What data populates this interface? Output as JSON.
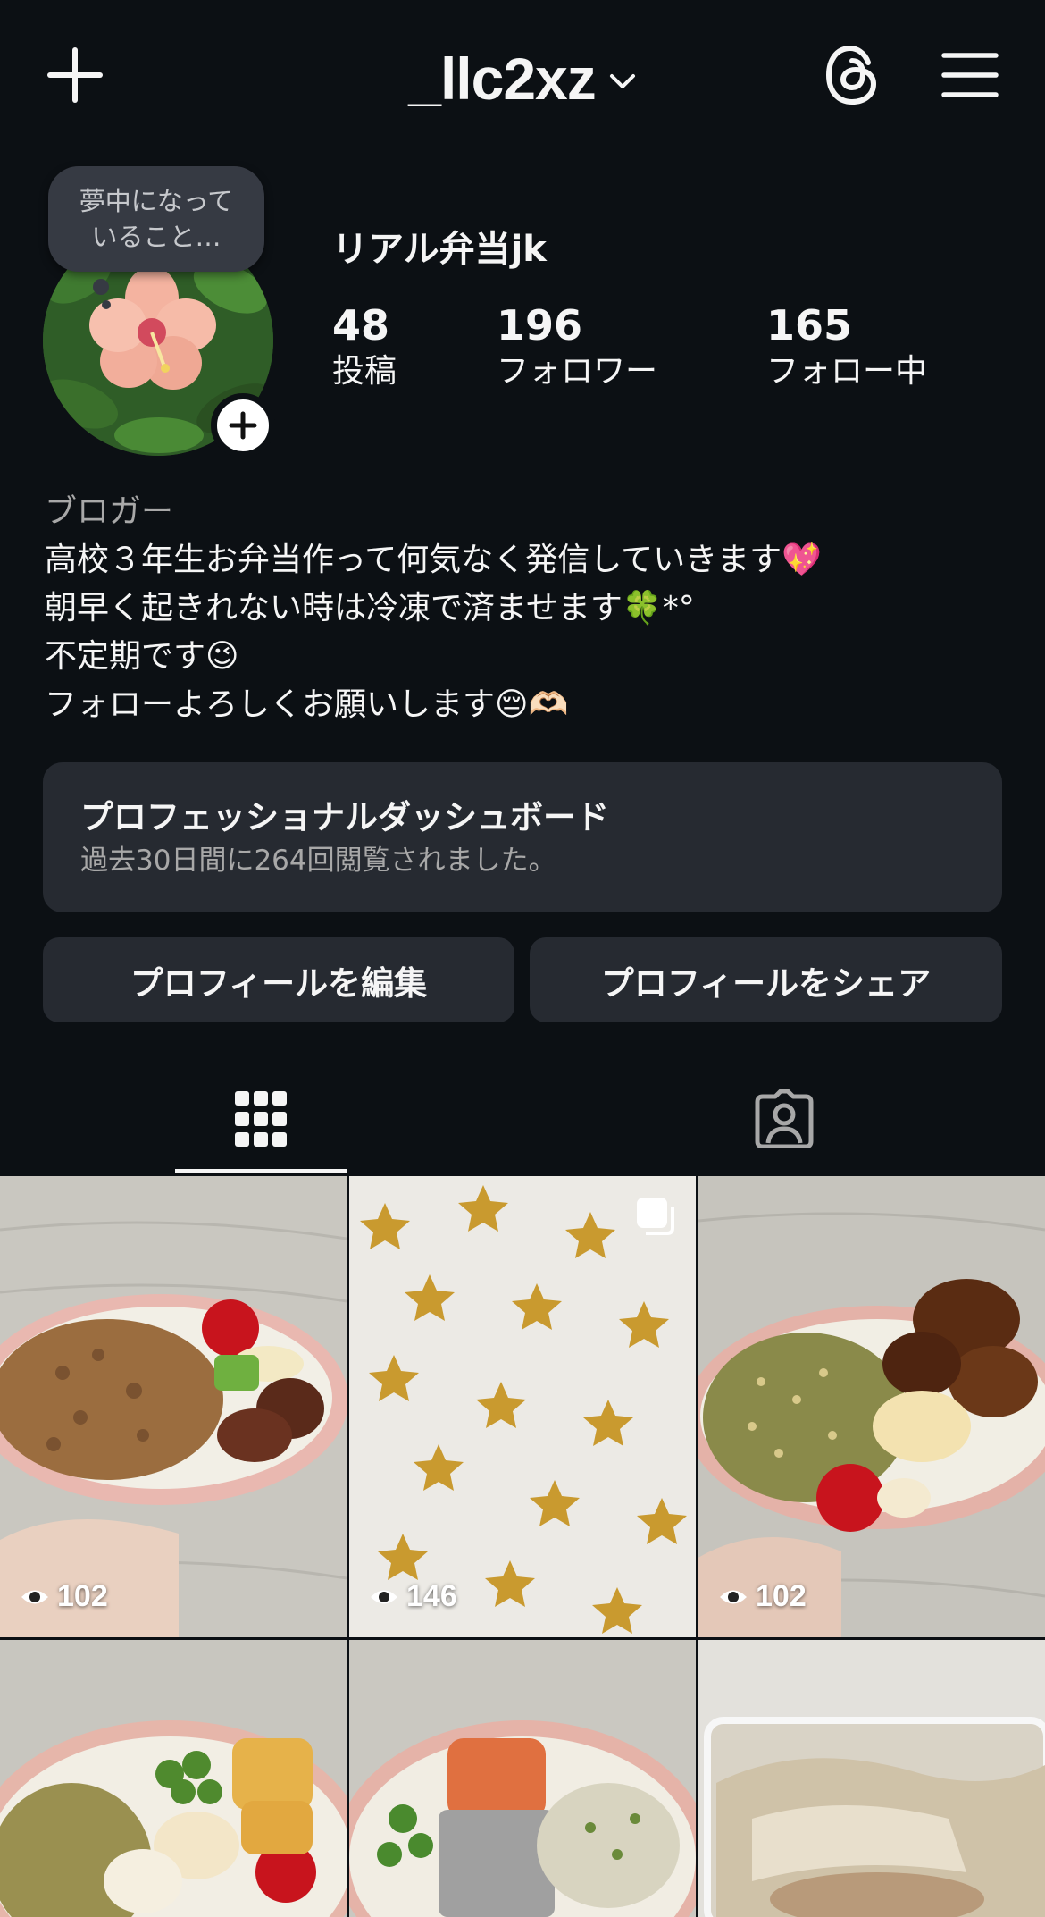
{
  "header": {
    "username": "_llc2xz",
    "icons": {
      "add": "plus-icon",
      "threads": "threads-icon",
      "menu": "hamburger-menu-icon",
      "dropdown": "chevron-down-icon"
    }
  },
  "profile": {
    "note": "夢中になって\nいること…",
    "display_name": "リアル弁当jk",
    "stats": [
      {
        "value": "48",
        "label": "投稿"
      },
      {
        "value": "196",
        "label": "フォロワー"
      },
      {
        "value": "165",
        "label": "フォロー中"
      }
    ]
  },
  "bio": {
    "category": "ブロガー",
    "lines": [
      "高校３年生お弁当作って何気なく発信していきます💖",
      "朝早く起きれない時は冷凍で済ませます🍀*°",
      "不定期です😉",
      "フォローよろしくお願いします😔🫶🏻"
    ]
  },
  "dashboard": {
    "title": "プロフェッショナルダッシュボード",
    "subtitle": "過去30日間に264回閲覧されました。"
  },
  "buttons": {
    "edit": "プロフィールを編集",
    "share": "プロフィールをシェア"
  },
  "tabs": {
    "grid": "grid-icon",
    "tagged": "tagged-person-icon"
  },
  "posts": [
    {
      "views": "102",
      "subject": "minced-meat-bento"
    },
    {
      "views": "146",
      "subject": "star-shaped-sweets",
      "multi": true
    },
    {
      "views": "102",
      "subject": "furikake-rice-bento"
    },
    {
      "views": "",
      "subject": "edamame-chikuwa-bento"
    },
    {
      "views": "",
      "subject": "salmon-bento"
    },
    {
      "views": "",
      "subject": "wrapped-food"
    }
  ]
}
